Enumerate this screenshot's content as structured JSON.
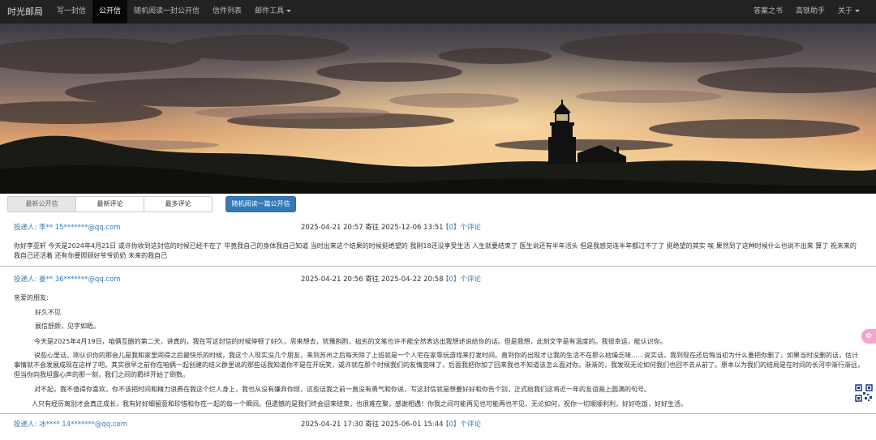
{
  "navbar": {
    "brand": "时光邮局",
    "items": [
      "写一封信",
      "公开信",
      "随机阅读一封公开信",
      "信件列表",
      "邮件工具"
    ],
    "right_items": [
      "答案之书",
      "高铁助手",
      "关于"
    ]
  },
  "tabs": {
    "items": [
      "最新公开信",
      "最新评论",
      "最多评论"
    ],
    "random_button": "随机阅读一篇公开信"
  },
  "letters": [
    {
      "author": "投递人: 李** 15*******@qq.com",
      "dates": "2025-04-21 20:57 寄往 2025-12-06 13:51",
      "comments": "【0】个评论",
      "body": "你好李亚轩 今天是2024年4月21日 或许你收到这封信的时候已经不在了 毕竟我自己的身体我自己知道 当时出来这个结果的时候挺绝望的 我刚18还没享受生活 人生就要结束了 医生说还有半年活头 但是我感觉连半年都过不了了 挺绝望的其实 唉 果然到了这种时候什么也说不出来 算了 祝未来的我自己还活着 还有你要照顾好爷爷奶奶 未来的我自己"
    },
    {
      "author": "投递人: 姜** 36*******@qq.com",
      "dates": "2025-04-21 20:56 寄往 2025-04-22 20:58",
      "comments": "【0】个评论",
      "salutation": "亲爱的朋友:",
      "line1": "好久不见",
      "line2": "展信舒颜，见字如晤。",
      "para1": "今天是2025年4月19日，咱俩互删的第二天，讲真的，我在写这封信的时候停顿了好久，思来想去，犹豫斟酌，拙劣的文笔也许不能全然表达出我想述说给你的话。但是我想，此刻文字是有温度的。我很幸运，能认识你。",
      "para2": "说些心里话，刚认识你的那会儿是我和家里闹得之后最快乐的时候，我这个人现实没几个朋友，来到苏州之后每天除了上班就是一个人宅在家靠玩游戏来打发时间。直到你的出现才让我的生活不在那么枯燥乏味……说实话，我到现在还后悔当初为什么要把你删了，如果当时没删的话，估计事情就不会发展成现在这样了吧。其实很早之前你在咱俩一起创建的结义群里说的那些话我知道你不是在开玩笑，或许就在那个时候我们的友情变味了，后面我把你加了回来我也不知道该怎么面对你。渐渐的，我发现无论如何我们也回不去从前了。原本以为我们的结局是在时间的长河中渐行渐远，但当你向我坦露心声的那一刻，我们之间的羁绊开始了倒数。",
      "para3": "对不起，我不值得你喜欢，你不该把时间和精力浪费在我这个烂人身上，我也从没有嫌弃你烦，这些话我之前一直没有勇气和你说，写这封信就是想要好好和你告个别，正式给我们这将近一年的友谊画上圆满的句号。",
      "para4": "人只有经历离别才会真正成长，我有好好细留意和珍惜和你在一起的每一个瞬间。但遗憾的是我们终会迎来结束，也很难在聚，感谢相遇！你我之间可能再见也可能再也不见，无论如何，祝你一切顺顺利利，好好吃饭，好好生活。"
    },
    {
      "author": "投递人: 冰**** 14*******@qq.com",
      "dates": "2025-04-21 17:30 寄往 2025-06-01 15:44",
      "comments": "【0】个评论"
    }
  ],
  "floating": {
    "bubble_icon": "chat-bubble",
    "qr_icon": "qr-code"
  }
}
